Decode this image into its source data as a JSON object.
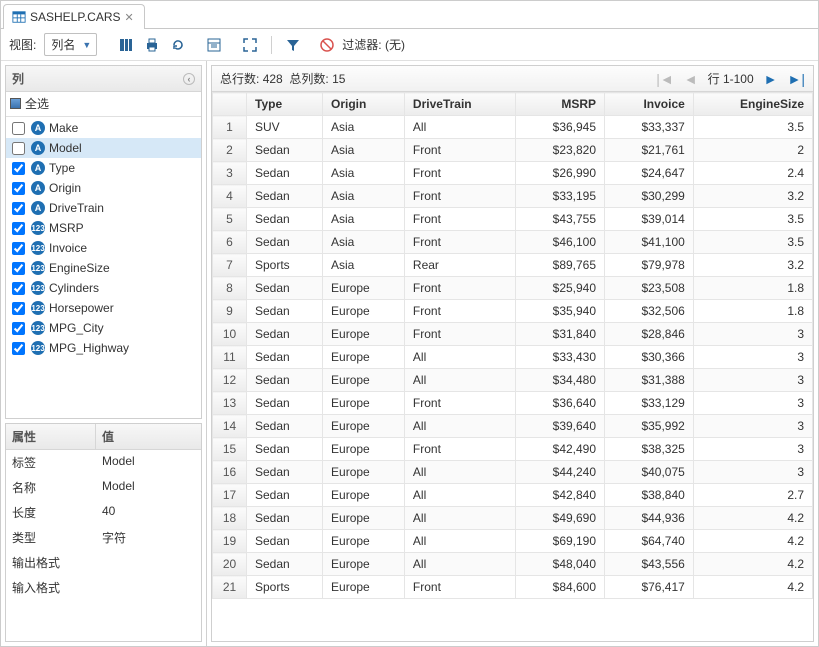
{
  "tab": {
    "title": "SASHELP.CARS"
  },
  "toolbar": {
    "view_label": "视图:",
    "view_value": "列名",
    "filter_prefix": "过滤器:",
    "filter_value": "(无)"
  },
  "columns_panel": {
    "title": "列",
    "select_all": "全选",
    "items": [
      {
        "name": "Make",
        "type": "A",
        "checked": false
      },
      {
        "name": "Model",
        "type": "A",
        "checked": false,
        "selected": true
      },
      {
        "name": "Type",
        "type": "A",
        "checked": true
      },
      {
        "name": "Origin",
        "type": "A",
        "checked": true
      },
      {
        "name": "DriveTrain",
        "type": "A",
        "checked": true
      },
      {
        "name": "MSRP",
        "type": "N",
        "checked": true
      },
      {
        "name": "Invoice",
        "type": "N",
        "checked": true
      },
      {
        "name": "EngineSize",
        "type": "N",
        "checked": true
      },
      {
        "name": "Cylinders",
        "type": "N",
        "checked": true
      },
      {
        "name": "Horsepower",
        "type": "N",
        "checked": true
      },
      {
        "name": "MPG_City",
        "type": "N",
        "checked": true
      },
      {
        "name": "MPG_Highway",
        "type": "N",
        "checked": true
      }
    ]
  },
  "properties": {
    "header_attr": "属性",
    "header_val": "值",
    "rows": [
      {
        "attr": "标签",
        "val": "Model"
      },
      {
        "attr": "名称",
        "val": "Model"
      },
      {
        "attr": "长度",
        "val": "40"
      },
      {
        "attr": "类型",
        "val": "字符"
      },
      {
        "attr": "输出格式",
        "val": ""
      },
      {
        "attr": "输入格式",
        "val": ""
      }
    ]
  },
  "grid": {
    "total_rows_label": "总行数:",
    "total_rows": "428",
    "total_cols_label": "总列数:",
    "total_cols": "15",
    "page_label": "行",
    "page_range": "1-100",
    "headers": [
      "Type",
      "Origin",
      "DriveTrain",
      "MSRP",
      "Invoice",
      "EngineSize"
    ],
    "align": [
      "l",
      "l",
      "l",
      "r",
      "r",
      "r"
    ],
    "rows": [
      [
        "SUV",
        "Asia",
        "All",
        "$36,945",
        "$33,337",
        "3.5"
      ],
      [
        "Sedan",
        "Asia",
        "Front",
        "$23,820",
        "$21,761",
        "2"
      ],
      [
        "Sedan",
        "Asia",
        "Front",
        "$26,990",
        "$24,647",
        "2.4"
      ],
      [
        "Sedan",
        "Asia",
        "Front",
        "$33,195",
        "$30,299",
        "3.2"
      ],
      [
        "Sedan",
        "Asia",
        "Front",
        "$43,755",
        "$39,014",
        "3.5"
      ],
      [
        "Sedan",
        "Asia",
        "Front",
        "$46,100",
        "$41,100",
        "3.5"
      ],
      [
        "Sports",
        "Asia",
        "Rear",
        "$89,765",
        "$79,978",
        "3.2"
      ],
      [
        "Sedan",
        "Europe",
        "Front",
        "$25,940",
        "$23,508",
        "1.8"
      ],
      [
        "Sedan",
        "Europe",
        "Front",
        "$35,940",
        "$32,506",
        "1.8"
      ],
      [
        "Sedan",
        "Europe",
        "Front",
        "$31,840",
        "$28,846",
        "3"
      ],
      [
        "Sedan",
        "Europe",
        "All",
        "$33,430",
        "$30,366",
        "3"
      ],
      [
        "Sedan",
        "Europe",
        "All",
        "$34,480",
        "$31,388",
        "3"
      ],
      [
        "Sedan",
        "Europe",
        "Front",
        "$36,640",
        "$33,129",
        "3"
      ],
      [
        "Sedan",
        "Europe",
        "All",
        "$39,640",
        "$35,992",
        "3"
      ],
      [
        "Sedan",
        "Europe",
        "Front",
        "$42,490",
        "$38,325",
        "3"
      ],
      [
        "Sedan",
        "Europe",
        "All",
        "$44,240",
        "$40,075",
        "3"
      ],
      [
        "Sedan",
        "Europe",
        "All",
        "$42,840",
        "$38,840",
        "2.7"
      ],
      [
        "Sedan",
        "Europe",
        "All",
        "$49,690",
        "$44,936",
        "4.2"
      ],
      [
        "Sedan",
        "Europe",
        "All",
        "$69,190",
        "$64,740",
        "4.2"
      ],
      [
        "Sedan",
        "Europe",
        "All",
        "$48,040",
        "$43,556",
        "4.2"
      ],
      [
        "Sports",
        "Europe",
        "Front",
        "$84,600",
        "$76,417",
        "4.2"
      ]
    ]
  }
}
